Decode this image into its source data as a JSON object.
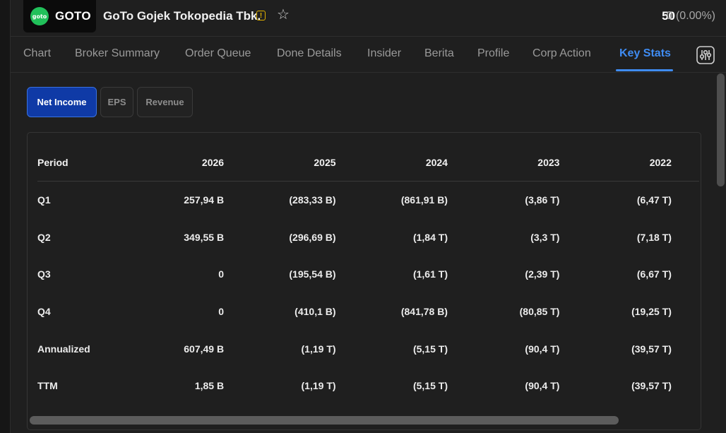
{
  "header": {
    "logo_icon_text": "goto",
    "ticker": "GOTO",
    "company_name": "GoTo Gojek Tokopedia Tbk.",
    "warning_icon": "!",
    "star_icon": "☆",
    "price": "50",
    "change": "0 (0.00%)"
  },
  "tabs": [
    {
      "label": "Chart"
    },
    {
      "label": "Broker Summary"
    },
    {
      "label": "Order Queue"
    },
    {
      "label": "Done Details"
    },
    {
      "label": "Insider"
    },
    {
      "label": "Berita"
    },
    {
      "label": "Profile"
    },
    {
      "label": "Corp Action"
    },
    {
      "label": "Key Stats"
    }
  ],
  "active_tab": "Key Stats",
  "segments": [
    {
      "label": "Net Income"
    },
    {
      "label": "EPS"
    },
    {
      "label": "Revenue"
    }
  ],
  "active_segment": "Net Income",
  "table": {
    "headers": [
      "Period",
      "2026",
      "2025",
      "2024",
      "2023",
      "2022"
    ],
    "rows": [
      [
        "Q1",
        "257,94 B",
        "(283,33 B)",
        "(861,91 B)",
        "(3,86 T)",
        "(6,47 T)"
      ],
      [
        "Q2",
        "349,55 B",
        "(296,69 B)",
        "(1,84 T)",
        "(3,3 T)",
        "(7,18 T)"
      ],
      [
        "Q3",
        "0",
        "(195,54 B)",
        "(1,61 T)",
        "(2,39 T)",
        "(6,67 T)"
      ],
      [
        "Q4",
        "0",
        "(410,1 B)",
        "(841,78 B)",
        "(80,85 T)",
        "(19,25 T)"
      ],
      [
        "Annualized",
        "607,49 B",
        "(1,19 T)",
        "(5,15 T)",
        "(90,4 T)",
        "(39,57 T)"
      ],
      [
        "TTM",
        "1,85 B",
        "(1,19 T)",
        "(5,15 T)",
        "(90,4 T)",
        "(39,57 T)"
      ]
    ]
  },
  "colors": {
    "accent": "#3f8cf3",
    "active_button": "#0f3aa6",
    "logo_green": "#21c05a",
    "warning": "#e0b000"
  },
  "icons": {
    "warning": "warning-icon",
    "favorite": "star-icon",
    "settings": "sliders-icon"
  }
}
